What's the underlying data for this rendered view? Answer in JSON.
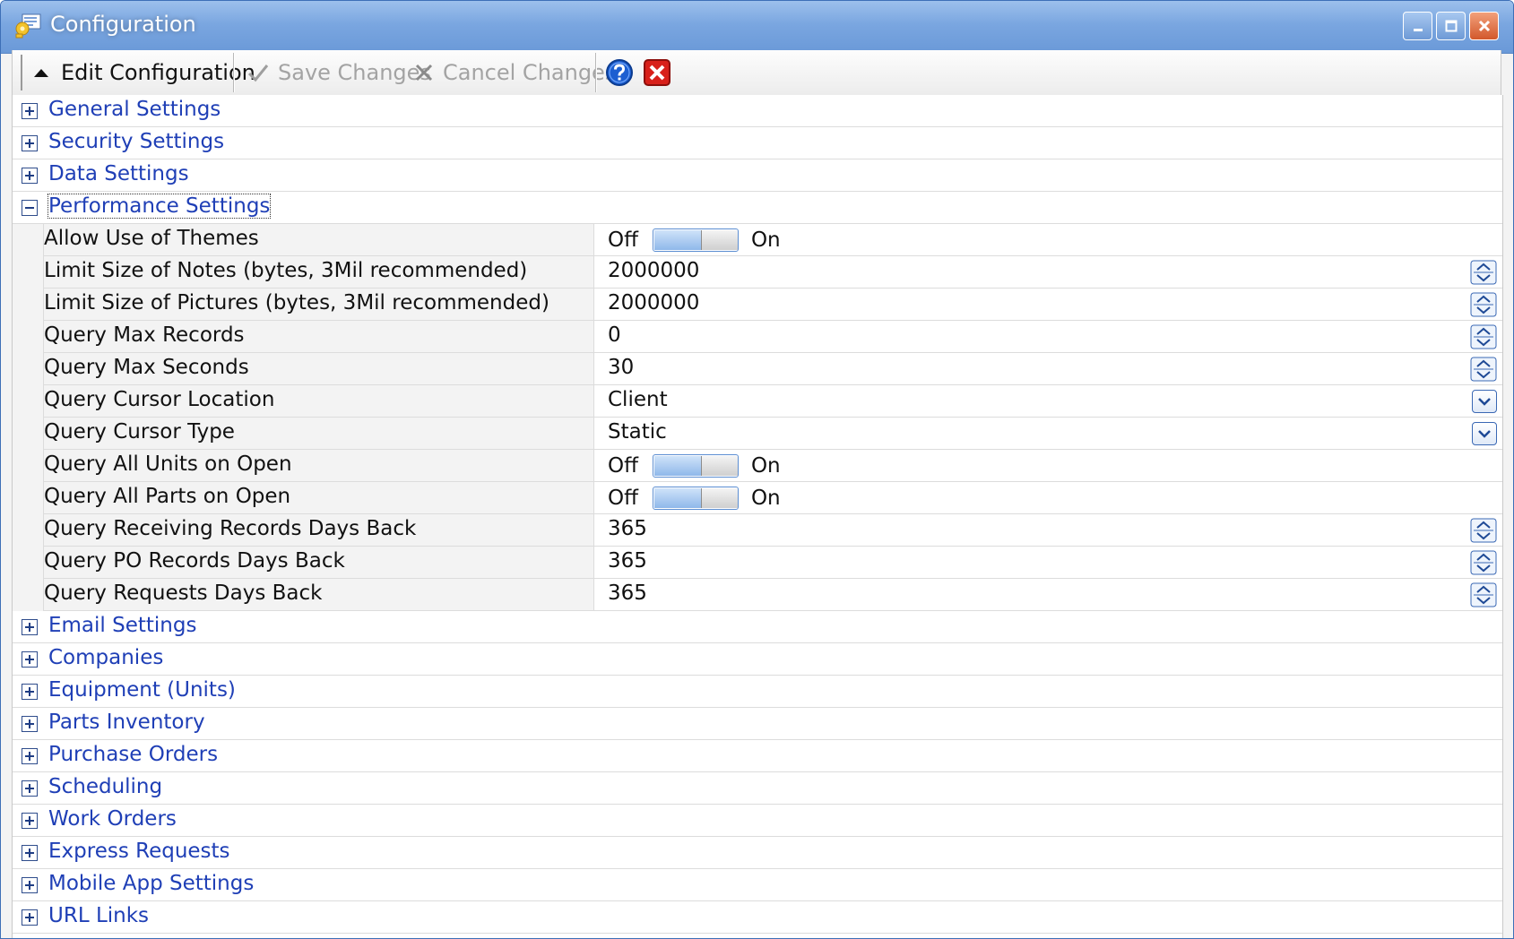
{
  "window": {
    "title": "Configuration"
  },
  "toolbar": {
    "edit_label": "Edit Configuration",
    "save_label": "Save Changes",
    "cancel_label": "Cancel Changes"
  },
  "categories_top": [
    {
      "label": "General Settings"
    },
    {
      "label": "Security Settings"
    },
    {
      "label": "Data Settings"
    }
  ],
  "performance": {
    "label": "Performance Settings",
    "rows": [
      {
        "name": "Allow Use of Themes",
        "off": "Off",
        "on": "On"
      },
      {
        "name": "Limit Size of Notes (bytes, 3Mil recommended)",
        "value": "2000000"
      },
      {
        "name": "Limit Size of Pictures (bytes, 3Mil recommended)",
        "value": "2000000"
      },
      {
        "name": "Query Max Records",
        "value": "0"
      },
      {
        "name": "Query Max Seconds",
        "value": "30"
      },
      {
        "name": "Query Cursor Location",
        "value": "Client"
      },
      {
        "name": "Query Cursor Type",
        "value": "Static"
      },
      {
        "name": "Query All Units on Open",
        "off": "Off",
        "on": "On"
      },
      {
        "name": "Query All Parts on Open",
        "off": "Off",
        "on": "On"
      },
      {
        "name": "Query Receiving Records Days Back",
        "value": "365"
      },
      {
        "name": "Query PO Records Days Back",
        "value": "365"
      },
      {
        "name": "Query Requests Days Back",
        "value": "365"
      }
    ]
  },
  "categories_bottom": [
    {
      "label": "Email Settings"
    },
    {
      "label": "Companies"
    },
    {
      "label": "Equipment (Units)"
    },
    {
      "label": "Parts Inventory"
    },
    {
      "label": "Purchase Orders"
    },
    {
      "label": "Scheduling"
    },
    {
      "label": "Work Orders"
    },
    {
      "label": "Express Requests"
    },
    {
      "label": "Mobile App Settings"
    },
    {
      "label": "URL Links"
    }
  ],
  "colors": {
    "category_text": "#1f3fb6",
    "titlebar": "#7aa6e0",
    "toggle_accent": "#8fb8ea"
  }
}
